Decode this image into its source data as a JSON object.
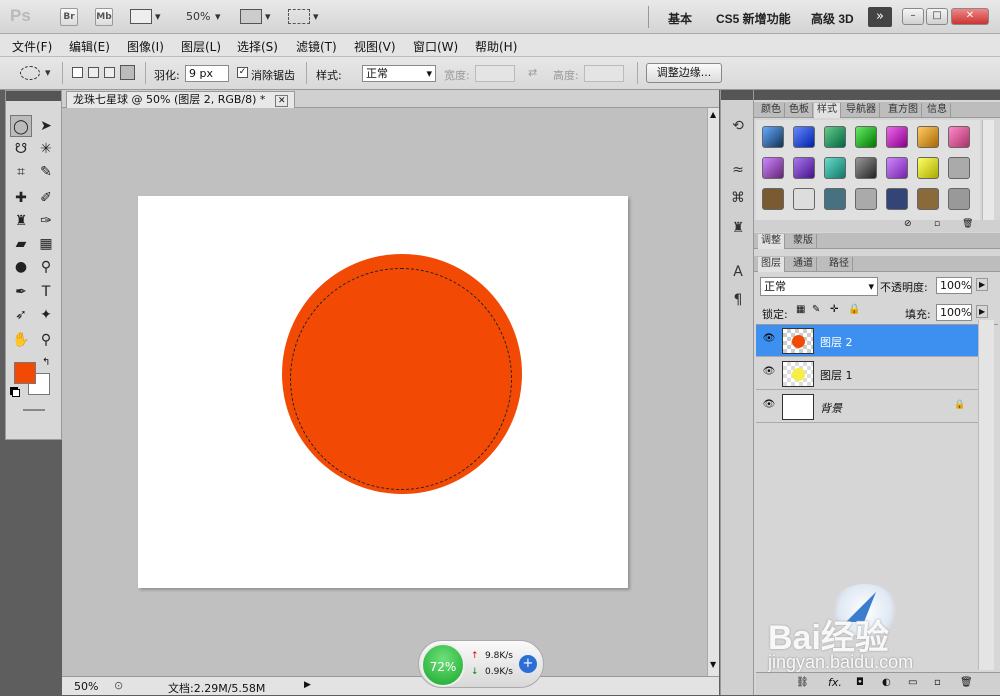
{
  "appbar": {
    "logo": "Ps",
    "bridge": "Br",
    "minibridge": "Mb",
    "zoom": "50%",
    "workspaces": [
      "基本",
      "CS5 新增功能",
      "高级 3D"
    ],
    "more": "»"
  },
  "menu": [
    "文件(F)",
    "编辑(E)",
    "图像(I)",
    "图层(L)",
    "选择(S)",
    "滤镜(T)",
    "视图(V)",
    "窗口(W)",
    "帮助(H)"
  ],
  "options": {
    "feather_label": "羽化:",
    "feather_value": "9 px",
    "antialias_label": "消除锯齿",
    "style_label": "样式:",
    "style_value": "正常",
    "width_label": "宽度:",
    "height_label": "高度:",
    "refine_edge": "调整边缘..."
  },
  "document": {
    "tab_title": "龙珠七星球 @ 50% (图层 2, RGB/8) *",
    "status_zoom": "50%",
    "status_doc": "文档:2.29M/5.58M",
    "circle_color": "#f24a05"
  },
  "panels": {
    "top_tabs": [
      "颜色",
      "色板",
      "样式",
      "导航器",
      "直方图",
      "信息"
    ],
    "active_top_tab": "样式",
    "mid_tabs": [
      "调整",
      "蒙版"
    ],
    "layer_tabs": [
      "图层",
      "通道",
      "路径"
    ],
    "blend_mode": "正常",
    "opacity_label": "不透明度:",
    "opacity_value": "100%",
    "lock_label": "锁定:",
    "fill_label": "填充:",
    "fill_value": "100%"
  },
  "layers": [
    {
      "name": "图层 2",
      "selected": true
    },
    {
      "name": "图层 1",
      "selected": false
    },
    {
      "name": "背景",
      "selected": false
    }
  ],
  "network": {
    "percent": "72%",
    "up": "9.8K/s",
    "down": "0.9K/s"
  },
  "watermark": {
    "brand": "Bai经验",
    "url": "jingyan.baidu.com"
  },
  "colors": {
    "foreground": "#f24a05",
    "background": "#ffffff",
    "selected_layer": "#3e90f0"
  }
}
